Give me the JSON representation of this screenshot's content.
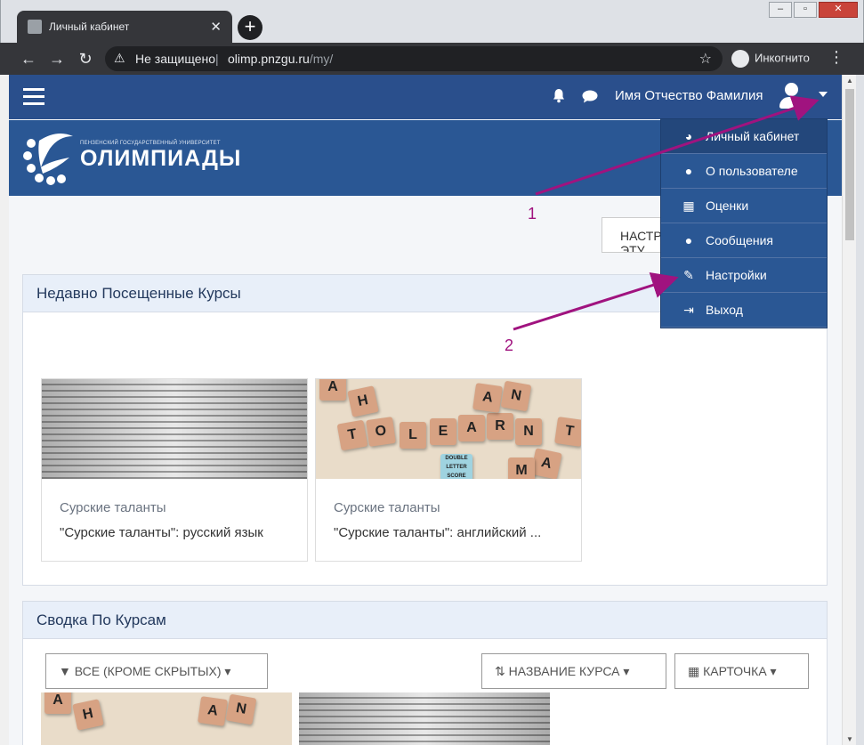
{
  "browser": {
    "tab_title": "Личный кабинет",
    "tab_close": "✕",
    "new_tab": "+",
    "insecure_label": "Не защищено",
    "url_host": "olimp.pnzgu.ru",
    "url_path": "/my/",
    "incognito_label": "Инкогнито",
    "window_buttons": [
      "–",
      "▫",
      "✕"
    ]
  },
  "navbar": {
    "user_name": "Имя Отчество Фамилия"
  },
  "banner": {
    "subtitle": "ПЕНЗЕНСКИЙ ГОСУДАРСТВЕННЫЙ УНИВЕРСИТЕТ",
    "title": "ОЛИМПИАДЫ"
  },
  "settings_button": "НАСТРОИТЬ ЭТУ СТРАНИЦУ",
  "recent": {
    "header": "Недавно Посещенные Курсы",
    "courses": [
      {
        "category": "Сурские таланты",
        "name": "\"Сурские таланты\": русский язык"
      },
      {
        "category": "Сурские таланты",
        "name": "\"Сурские таланты\": английский ..."
      }
    ]
  },
  "overview": {
    "header": "Сводка По Курсам",
    "filter_label": "ВСЕ (КРОМЕ СКРЫТЫХ)",
    "sort_label": "НАЗВАНИЕ КУРСА",
    "view_label": "КАРТОЧКА"
  },
  "user_menu": {
    "items": [
      {
        "label": "Личный кабинет",
        "icon": "dashboard-icon"
      },
      {
        "label": "О пользователе",
        "icon": "user-icon"
      },
      {
        "label": "Оценки",
        "icon": "table-icon"
      },
      {
        "label": "Сообщения",
        "icon": "comment-icon"
      },
      {
        "label": "Настройки",
        "icon": "wrench-icon"
      },
      {
        "label": "Выход",
        "icon": "sign-out-icon"
      }
    ]
  },
  "annotations": [
    "1",
    "2"
  ],
  "colors": {
    "navbar": "#2a4f8c",
    "banner": "#2a5794",
    "menu": "#2a5794",
    "annotation": "#a0137f"
  }
}
